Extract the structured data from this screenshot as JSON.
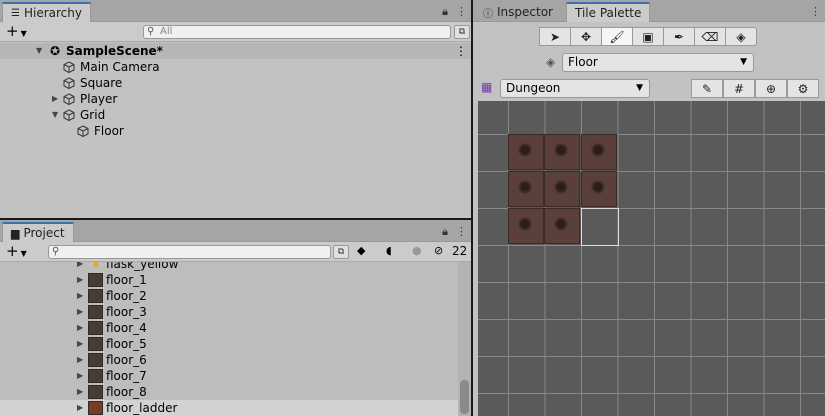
{
  "hierarchy": {
    "tab_title": "Hierarchy",
    "add_label": "+",
    "search_placeholder": "All",
    "scene_name": "SampleScene*",
    "items": [
      {
        "label": "Main Camera"
      },
      {
        "label": "Square"
      },
      {
        "label": "Player"
      },
      {
        "label": "Grid"
      },
      {
        "label": "Floor"
      }
    ]
  },
  "project": {
    "tab_title": "Project",
    "add_label": "+",
    "hidden_count": "22",
    "items": [
      {
        "label": "flask_yellow"
      },
      {
        "label": "floor_1"
      },
      {
        "label": "floor_2"
      },
      {
        "label": "floor_3"
      },
      {
        "label": "floor_4"
      },
      {
        "label": "floor_5"
      },
      {
        "label": "floor_6"
      },
      {
        "label": "floor_7"
      },
      {
        "label": "floor_8"
      },
      {
        "label": "floor_ladder"
      }
    ]
  },
  "right_panel": {
    "tabs": [
      {
        "label": "Inspector"
      },
      {
        "label": "Tile Palette"
      }
    ],
    "active_tab": "Tile Palette",
    "active_tilemap": "Floor",
    "palette": "Dungeon"
  },
  "colors": {
    "panel_bg": "#c2c2c2",
    "tab_accent": "#3a72b0",
    "grid_bg": "#5a5a5a",
    "tile": "#5a3f3a"
  }
}
